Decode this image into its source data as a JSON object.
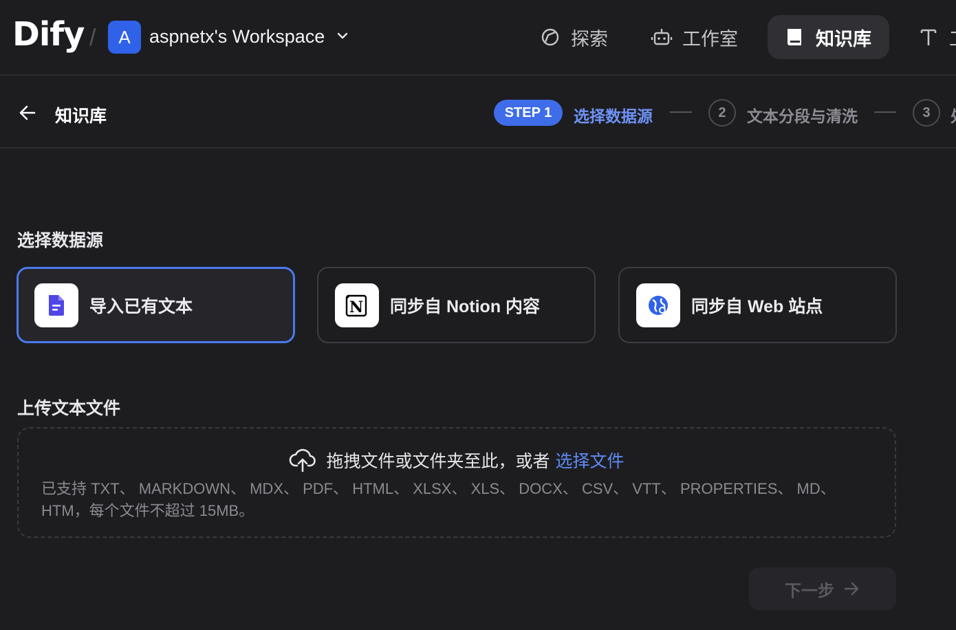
{
  "app": {
    "logo": "Dify",
    "separator": "/"
  },
  "workspace": {
    "avatar_letter": "A",
    "name": "aspnetx's Workspace"
  },
  "nav": {
    "items": [
      {
        "label": "探索",
        "icon": "compass-icon"
      },
      {
        "label": "工作室",
        "icon": "robot-icon"
      },
      {
        "label": "知识库",
        "icon": "book-icon",
        "active": true
      },
      {
        "label": "工",
        "icon": "tools-icon"
      }
    ]
  },
  "breadcrumb": {
    "title": "知识库"
  },
  "steps": {
    "step1_badge": "STEP 1",
    "step1_label": "选择数据源",
    "step2_number": "2",
    "step2_label": "文本分段与清洗",
    "step3_number": "3",
    "step3_label": "处"
  },
  "datasource": {
    "title": "选择数据源",
    "options": [
      {
        "label": "导入已有文本",
        "icon": "file-text-icon",
        "selected": true
      },
      {
        "label": "同步自 Notion 内容",
        "icon": "notion-icon",
        "selected": false
      },
      {
        "label": "同步自 Web 站点",
        "icon": "globe-icon",
        "selected": false
      }
    ]
  },
  "upload": {
    "title": "上传文本文件",
    "drag_text": "拖拽文件或文件夹至此，或者",
    "select_link": "选择文件",
    "supported": "已支持 TXT、 MARKDOWN、 MDX、 PDF、 HTML、 XLSX、 XLS、 DOCX、 CSV、 VTT、 PROPERTIES、 MD、 HTM，每个文件不超过 15MB。"
  },
  "footer": {
    "next_label": "下一步"
  },
  "colors": {
    "accent": "#3f6de9",
    "link": "#5f8af5",
    "background": "#1d1d20"
  }
}
